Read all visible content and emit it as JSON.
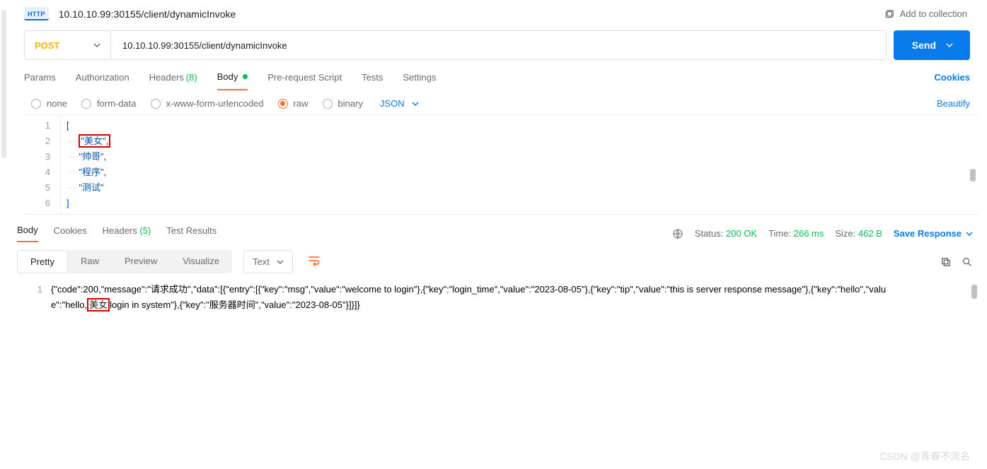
{
  "header": {
    "http_badge": "HTTP",
    "name": "10.10.10.99:30155/client/dynamicInvoke",
    "add_to_collection": "Add to collection"
  },
  "request": {
    "method": "POST",
    "url": "10.10.10.99:30155/client/dynamicInvoke",
    "send_label": "Send"
  },
  "tabs": {
    "params": "Params",
    "authorization": "Authorization",
    "headers": "Headers",
    "headers_count": "(8)",
    "body": "Body",
    "prerequest": "Pre-request Script",
    "tests": "Tests",
    "settings": "Settings",
    "cookies": "Cookies"
  },
  "body_types": {
    "none": "none",
    "form_data": "form-data",
    "urlencoded": "x-www-form-urlencoded",
    "raw": "raw",
    "binary": "binary",
    "json": "JSON",
    "beautify": "Beautify"
  },
  "request_body": {
    "lines": [
      "1",
      "2",
      "3",
      "4",
      "5",
      "6"
    ],
    "l1_bracket": "[",
    "l2_str": "\"美女\"",
    "l2_comma": ",",
    "l3_str": "\"帅哥\"",
    "l3_comma": ",",
    "l4_str": "\"程序\"",
    "l4_comma": ",",
    "l5_str": "\"测试\"",
    "l6_bracket": "]"
  },
  "response_tabs": {
    "body": "Body",
    "cookies": "Cookies",
    "headers": "Headers",
    "headers_count": "(5)",
    "test_results": "Test Results"
  },
  "response_meta": {
    "status_label": "Status:",
    "status_value": "200 OK",
    "time_label": "Time:",
    "time_value": "266 ms",
    "size_label": "Size:",
    "size_value": "462 B",
    "save_response": "Save Response"
  },
  "viewer": {
    "pretty": "Pretty",
    "raw": "Raw",
    "preview": "Preview",
    "visualize": "Visualize",
    "format": "Text"
  },
  "response_body": {
    "line_num": "1",
    "seg1": "{\"code\":200,\"message\":\"请求成功\",\"data\":[{\"entry\":[{\"key\":\"msg\",\"value\":\"welcome to login\"},{\"key\":\"login_time\",\"value\":\"2023-08-05\"},{\"key\":\"tip\",\"value\":\"this is server response message\"},{\"key\":\"hello\",\"value\":\"hello,",
    "highlight": "美女",
    "seg2": "login in system\"},{\"key\":\"服务器时间\",\"value\":\"2023-08-05\"}]}]}"
  },
  "watermark": "CSDN @青春不流名"
}
